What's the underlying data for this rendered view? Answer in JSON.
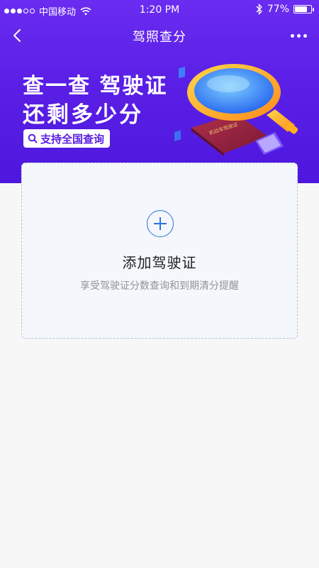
{
  "status_bar": {
    "carrier": "中国移动",
    "time": "1:20 PM",
    "battery": "77%",
    "battery_level": 0.77
  },
  "nav": {
    "title": "驾照查分",
    "back_icon": "chevron-left-icon",
    "more_icon": "more-dots-icon"
  },
  "banner": {
    "line1": "查一查 驾驶证",
    "line2": "还剩多少分",
    "tag": "支持全国查询"
  },
  "card": {
    "title": "添加驾驶证",
    "subtitle": "享受驾驶证分数查询和到期清分提醒"
  },
  "colors": {
    "header_bg": "#5a1fe6",
    "accent_blue": "#2f6fe0",
    "card_bg": "#f4f7fb"
  }
}
